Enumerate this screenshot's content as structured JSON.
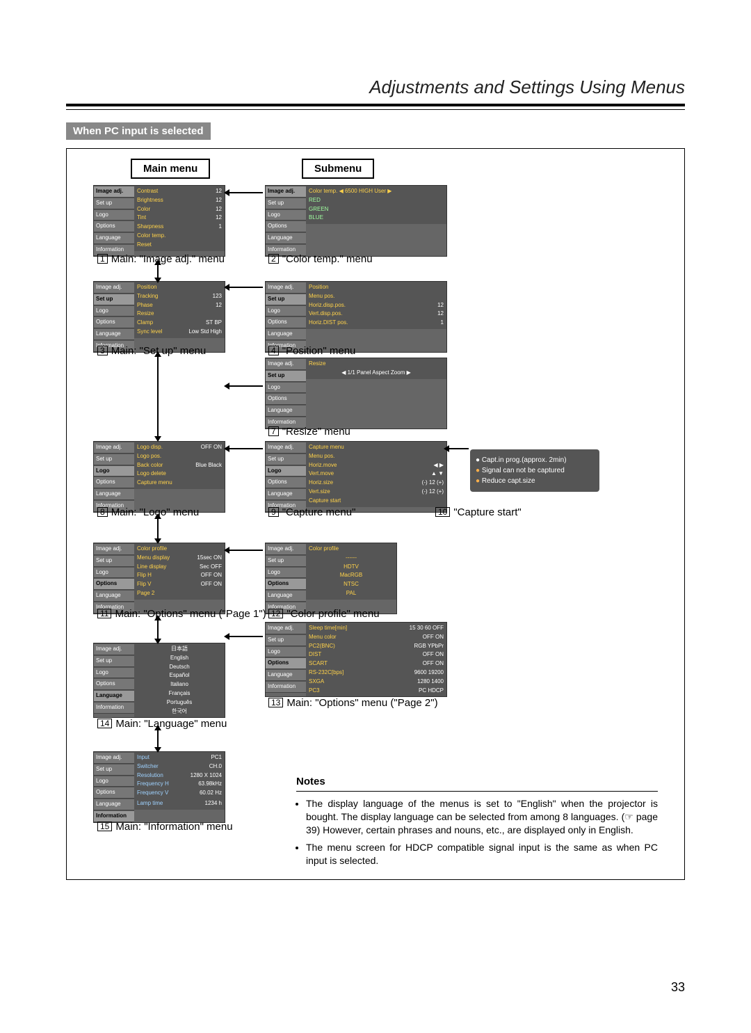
{
  "page": {
    "header_title": "Adjustments and Settings Using Menus",
    "section_badge": "When PC input is selected",
    "page_number": "33"
  },
  "col_headings": {
    "main": "Main menu",
    "sub": "Submenu"
  },
  "sidebar_items": [
    "Image adj.",
    "Set up",
    "Logo",
    "Options",
    "Language",
    "Information"
  ],
  "captions": {
    "c1": "Main: \"Image adj.\" menu",
    "c2": "\"Color temp.\" menu",
    "c3": "Main: \"Set up\" menu",
    "c4": "\"Position\" menu",
    "c7": "\"Resize\" menu",
    "c8": "Main: \"Logo\" menu",
    "c9": "\"Capture menu\"",
    "c10": "\"Capture start\"",
    "c11": "Main: \"Options\" menu (\"Page 1\")",
    "c12": "\"Color profile\" menu",
    "c13": "Main: \"Options\" menu (\"Page 2\")",
    "c14": "Main: \"Language\" menu",
    "c15": "Main: \"Information\" menu"
  },
  "nums": {
    "n1": "1",
    "n2": "2",
    "n3": "3",
    "n4": "4",
    "n7": "7",
    "n8": "8",
    "n9": "9",
    "n10": "10",
    "n11": "11",
    "n12": "12",
    "n13": "13",
    "n14": "14",
    "n15": "15"
  },
  "osd": {
    "image_adj": {
      "rows": [
        [
          "Contrast",
          "12"
        ],
        [
          "Brightness",
          "12"
        ],
        [
          "Color",
          "12"
        ],
        [
          "Tint",
          "12"
        ],
        [
          "Sharpness",
          "1"
        ],
        [
          "Color temp.",
          ""
        ],
        [
          "Reset",
          ""
        ]
      ]
    },
    "color_temp": {
      "header": "Color temp. ◀ 6500 HIGH User ▶",
      "rows": [
        [
          "RED",
          ""
        ],
        [
          "GREEN",
          ""
        ],
        [
          "BLUE",
          ""
        ]
      ]
    },
    "setup": {
      "rows": [
        [
          "Position",
          ""
        ],
        [
          "Tracking",
          "123"
        ],
        [
          "Phase",
          "12"
        ],
        [
          "Resize",
          ""
        ],
        [
          "Clamp",
          "ST  BP"
        ],
        [
          "Sync level",
          "Low Std High"
        ]
      ]
    },
    "position": {
      "header": "Position",
      "rows": [
        [
          "Menu pos.",
          ""
        ],
        [
          "Horiz.disp.pos.",
          "12"
        ],
        [
          "Vert.disp.pos.",
          "12"
        ],
        [
          "Horiz.DIST pos.",
          "1"
        ]
      ]
    },
    "resize": {
      "header": "Resize",
      "row": "◀  1/1  Panel  Aspect  Zoom ▶"
    },
    "logo": {
      "rows": [
        [
          "Logo disp.",
          "OFF  ON"
        ],
        [
          "Logo pos.",
          ""
        ],
        [
          "Back color",
          "Blue  Black"
        ],
        [
          "Logo delete",
          ""
        ],
        [
          "Capture menu",
          ""
        ]
      ]
    },
    "capture": {
      "rows": [
        [
          "Capture menu",
          ""
        ],
        [
          "Menu pos.",
          ""
        ],
        [
          "Horiz.move",
          "◀   ▶"
        ],
        [
          "Vert.move",
          "▲   ▼"
        ],
        [
          "Horiz.size",
          "(-)  12  (+)"
        ],
        [
          "Vert.size",
          "(-)  12  (+)"
        ],
        [
          "Capture start",
          ""
        ]
      ]
    },
    "options1": {
      "rows": [
        [
          "Color profile",
          ""
        ],
        [
          "Menu display",
          "15sec  ON"
        ],
        [
          "Line display",
          "Sec  OFF"
        ],
        [
          "Flip H",
          "OFF  ON"
        ],
        [
          "Flip V",
          "OFF  ON"
        ],
        [
          "Page 2",
          ""
        ]
      ]
    },
    "color_profile": {
      "header": "Color profile",
      "rows": [
        "------",
        "HDTV",
        "MacRGB",
        "NTSC",
        "PAL"
      ]
    },
    "options2": {
      "rows": [
        [
          "Sleep time[min]",
          "15  30  60  OFF"
        ],
        [
          "Menu color",
          "OFF  ON"
        ],
        [
          "PC2(BNC)",
          "RGB  YPbPr"
        ],
        [
          "DIST",
          "OFF  ON"
        ],
        [
          "SCART",
          "OFF  ON"
        ],
        [
          "RS-232C[bps]",
          "9600  19200"
        ],
        [
          "SXGA",
          "1280  1400"
        ],
        [
          "PC3",
          "PC  HDCP"
        ]
      ]
    },
    "language": {
      "rows": [
        "日本語",
        "English",
        "Deutsch",
        "Español",
        "Italiano",
        "Français",
        "Português",
        "한국어"
      ]
    },
    "information": {
      "rows": [
        [
          "Input",
          "PC1"
        ],
        [
          "Switcher",
          "CH.0"
        ],
        [
          "Resolution",
          "1280 X 1024"
        ],
        [
          "Frequency H",
          "63.98kHz"
        ],
        [
          "Frequency V",
          "60.02 Hz"
        ],
        [
          "",
          ""
        ],
        [
          "Lamp time",
          "1234 h"
        ]
      ]
    }
  },
  "popup": {
    "l1": "Capt.in prog.(approx. 2min)",
    "l2": "Signal can not be captured",
    "l3": "Reduce capt.size"
  },
  "notes": {
    "title": "Notes",
    "b1": "The display language of the menus is set to \"English\" when the projector is bought. The display language can be selected from among 8 languages. (☞ page 39) However, certain phrases and nouns, etc., are displayed only in English.",
    "b2": "The menu screen for HDCP compatible signal input is the same as when PC input is selected."
  }
}
